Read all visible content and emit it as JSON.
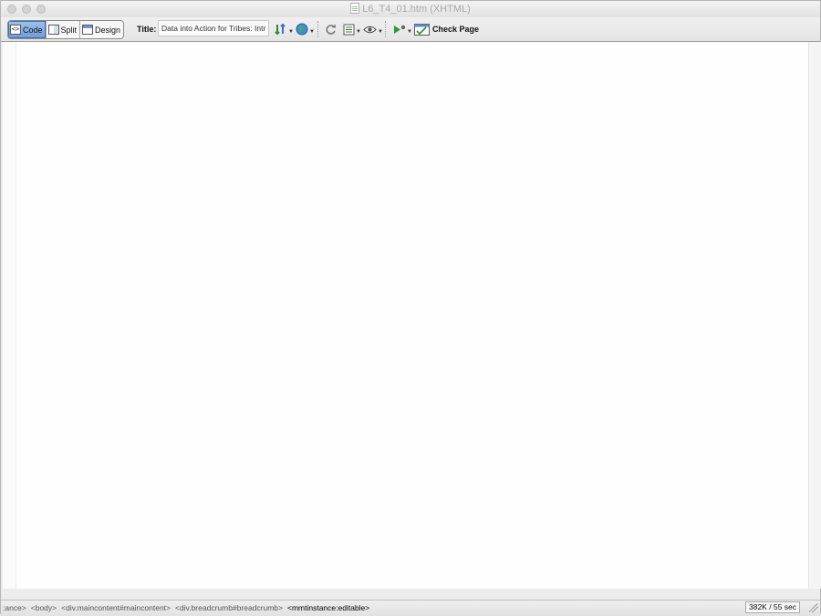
{
  "window": {
    "title": "L6_T4_01.htm (XHTML)"
  },
  "toolbar": {
    "view_buttons": [
      {
        "label": "Code",
        "active": true
      },
      {
        "label": "Split",
        "active": false
      },
      {
        "label": "Design",
        "active": false
      }
    ],
    "title_label": "Title:",
    "title_value": "Data into Action for Tribes: Intr",
    "icons": [
      "file-management-icon",
      "preview-browser-icon",
      "refresh-icon",
      "view-options-icon",
      "visual-aids-icon",
      "validate-icon",
      "check-page-icon"
    ],
    "check_page_label": "Check Page"
  },
  "statusbar": {
    "tags": [
      ":ance>",
      "<body>",
      "<div.maincontent#maincontent>",
      "<div.breadcrumb#breadcrumb>",
      "<mmtinstance:editable>"
    ],
    "size_time": "382K / 55 sec"
  },
  "colors": {
    "active_view": "#7aa5dd",
    "editor_bg": "#fefefe"
  }
}
